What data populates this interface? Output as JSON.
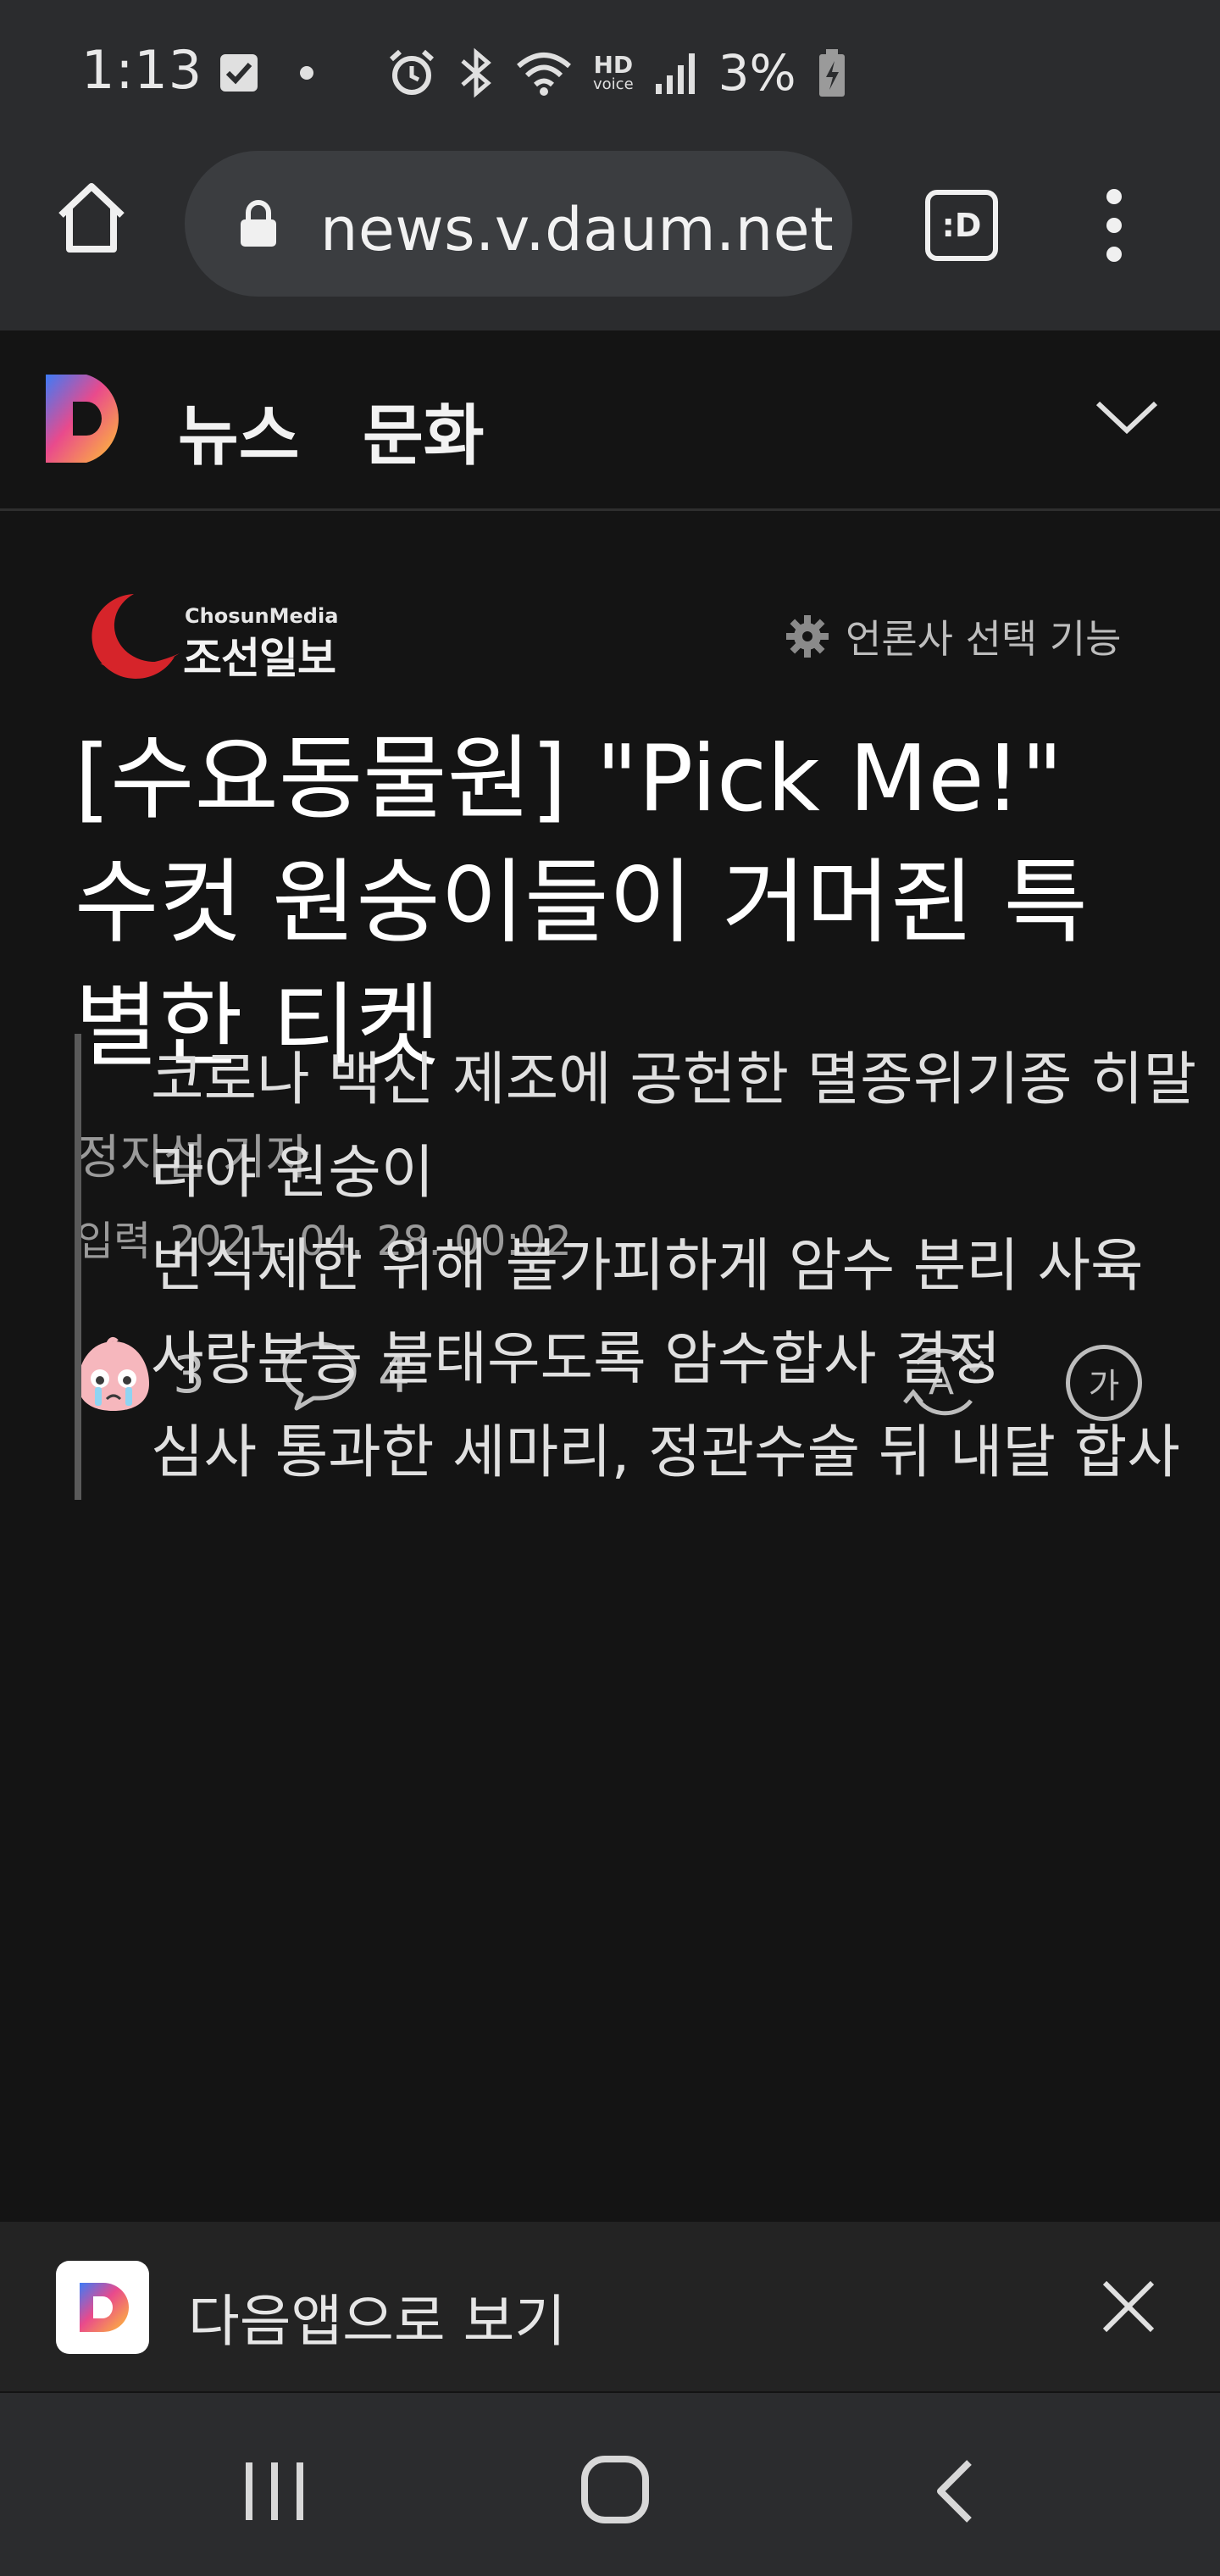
{
  "status_bar": {
    "time": "1:13",
    "battery": "3%",
    "network_badge_top": "HD",
    "network_badge_bottom": "voice",
    "icons": [
      "checkbox-notification-icon",
      "dot-icon",
      "alarm-icon",
      "bluetooth-icon",
      "wifi-icon",
      "hd-voice-icon",
      "signal-icon",
      "battery-charging-icon"
    ]
  },
  "browser": {
    "url": "news.v.daum.net",
    "tab_label": ":D",
    "icons": [
      "home-icon",
      "lock-icon",
      "tab-switcher-icon",
      "more-vert-icon"
    ]
  },
  "site_header": {
    "logo_letter": "D",
    "section_news": "뉴스",
    "section_culture": "문화",
    "icons": [
      "daum-logo-icon",
      "chevron-down-icon"
    ]
  },
  "article": {
    "press_name_en": "ChosunMedia",
    "press_name_ko": "조선일보",
    "press_select_label": "언론사 선택 기능",
    "title": "[수요동물원] \"Pick Me!\" 수컷 원숭이들이 거머쥔 특별한 티켓",
    "author": "정지섭 기자",
    "date_label": "입력",
    "date_value": "2021. 04. 28. 00:02",
    "emotion_count": "3",
    "comment_count": "4",
    "translate_label": "A",
    "fontsize_label": "가",
    "summary_lines": [
      "코로나 백신 제조에 공헌한 멸종위기종 히말라야 원숭이",
      "번식제한 위해 불가피하게 암수 분리 사육",
      "사랑본능 불태우도록 암수합사 결정",
      "심사 통과한 세마리, 정관수술 뒤 내달 합사"
    ]
  },
  "app_banner": {
    "label": "다음앱으로 보기",
    "logo_letter": "D"
  },
  "colors": {
    "background": "#141414",
    "chrome": "#2b2c2e",
    "url_pill": "#3b3d40",
    "press_red": "#d6242a",
    "muted_text": "#9a9a9a"
  }
}
